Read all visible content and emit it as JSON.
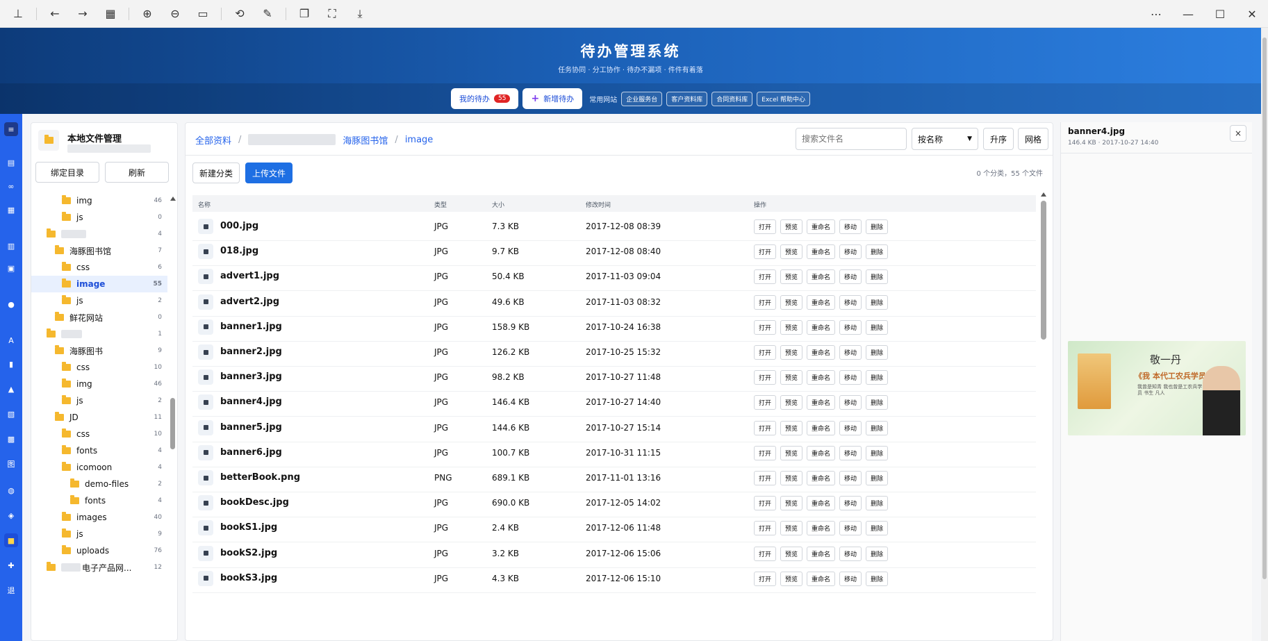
{
  "app": {
    "title": "待办管理系统",
    "subtitle": "任务协同 · 分工协作 · 待办不漏项 · 件件有着落",
    "nav": {
      "my_todos_label": "我的待办",
      "my_todos_count": "55",
      "new_todo_label": "新增待办",
      "common_sites_label": "常用网站",
      "sites": [
        "企业服务台",
        "客户资料库",
        "合同资料库",
        "Excel 帮助中心"
      ]
    }
  },
  "rail": {
    "items": [
      "menu-icon",
      "document-icon",
      "link-icon",
      "calendar-icon",
      "book-icon",
      "clipboard-icon",
      "chat-icon",
      "font-icon",
      "chart-icon",
      "bell-icon",
      "report-icon",
      "building-icon",
      "image-icon",
      "globe-icon",
      "cube-icon",
      "folder-icon",
      "puzzle-icon",
      "logout-icon"
    ],
    "labels": {
      "font": "A",
      "image": "图",
      "logout": "退"
    }
  },
  "file_tree": {
    "title": "本地文件管理",
    "bind_dir_label": "绑定目录",
    "refresh_label": "刷新",
    "items": [
      {
        "label": "img",
        "count": "46"
      },
      {
        "label": "js",
        "count": "0"
      },
      {
        "label": "",
        "count": "4"
      },
      {
        "label": "海豚图书馆",
        "count": "7"
      },
      {
        "label": "css",
        "count": "6"
      },
      {
        "label": "image",
        "count": "55"
      },
      {
        "label": "js",
        "count": "2"
      },
      {
        "label": "鲜花网站",
        "count": "0"
      },
      {
        "label": "",
        "count": "1"
      },
      {
        "label": "海豚图书",
        "count": "9"
      },
      {
        "label": "css",
        "count": "10"
      },
      {
        "label": "img",
        "count": "46"
      },
      {
        "label": "js",
        "count": "2"
      },
      {
        "label": "JD",
        "count": "11"
      },
      {
        "label": "css",
        "count": "10"
      },
      {
        "label": "fonts",
        "count": "4"
      },
      {
        "label": "icomoon",
        "count": "4"
      },
      {
        "label": "demo-files",
        "count": "2"
      },
      {
        "label": "fonts",
        "count": "4"
      },
      {
        "label": "images",
        "count": "40"
      },
      {
        "label": "js",
        "count": "9"
      },
      {
        "label": "uploads",
        "count": "76"
      },
      {
        "label": "电子产品网...",
        "count": "12"
      }
    ]
  },
  "main": {
    "breadcrumb": [
      "全部资料",
      "海豚图书馆",
      "image"
    ],
    "search_placeholder": "搜索文件名",
    "sort_by": "按名称",
    "order_label": "升序",
    "view_label": "网格",
    "new_category_label": "新建分类",
    "upload_label": "上传文件",
    "summary": "0 个分类，55 个文件",
    "columns": [
      "名称",
      "类型",
      "大小",
      "修改时间",
      "操作"
    ],
    "actions": [
      "打开",
      "预览",
      "重命名",
      "移动",
      "删除"
    ],
    "rows": [
      {
        "name": "000.jpg",
        "type": "JPG",
        "size": "7.3 KB",
        "time": "2017-12-08 08:39"
      },
      {
        "name": "018.jpg",
        "type": "JPG",
        "size": "9.7 KB",
        "time": "2017-12-08 08:40"
      },
      {
        "name": "advert1.jpg",
        "type": "JPG",
        "size": "50.4 KB",
        "time": "2017-11-03 09:04"
      },
      {
        "name": "advert2.jpg",
        "type": "JPG",
        "size": "49.6 KB",
        "time": "2017-11-03 08:32"
      },
      {
        "name": "banner1.jpg",
        "type": "JPG",
        "size": "158.9 KB",
        "time": "2017-10-24 16:38"
      },
      {
        "name": "banner2.jpg",
        "type": "JPG",
        "size": "126.2 KB",
        "time": "2017-10-25 15:32"
      },
      {
        "name": "banner3.jpg",
        "type": "JPG",
        "size": "98.2 KB",
        "time": "2017-10-27 11:48"
      },
      {
        "name": "banner4.jpg",
        "type": "JPG",
        "size": "146.4 KB",
        "time": "2017-10-27 14:40"
      },
      {
        "name": "banner5.jpg",
        "type": "JPG",
        "size": "144.6 KB",
        "time": "2017-10-27 15:14"
      },
      {
        "name": "banner6.jpg",
        "type": "JPG",
        "size": "100.7 KB",
        "time": "2017-10-31 11:15"
      },
      {
        "name": "betterBook.png",
        "type": "PNG",
        "size": "689.1 KB",
        "time": "2017-11-01 13:16"
      },
      {
        "name": "bookDesc.jpg",
        "type": "JPG",
        "size": "690.0 KB",
        "time": "2017-12-05 14:02"
      },
      {
        "name": "bookS1.jpg",
        "type": "JPG",
        "size": "2.4 KB",
        "time": "2017-12-06 11:48"
      },
      {
        "name": "bookS2.jpg",
        "type": "JPG",
        "size": "3.2 KB",
        "time": "2017-12-06 15:06"
      },
      {
        "name": "bookS3.jpg",
        "type": "JPG",
        "size": "4.3 KB",
        "time": "2017-12-06 15:10"
      }
    ]
  },
  "preview": {
    "name": "banner4.jpg",
    "meta": "146.4 KB · 2017-10-27 14:40",
    "close": "×",
    "image_text_1": "敬一丹",
    "image_text_2": "《我 本代工农兵学员》",
    "image_text_3": "我曾是知青 我也曾是工农兵学员 书生 凡人"
  },
  "toolbar": {
    "icons": [
      "pin-icon",
      "back-icon",
      "forward-icon",
      "grid-icon",
      "zoom-in-icon",
      "zoom-out-icon",
      "fit-icon",
      "rotate-icon",
      "edit-icon",
      "copy-icon",
      "screenshot-icon",
      "save-icon"
    ],
    "glyphs": {
      "pin": "⊥",
      "back": "←",
      "forward": "→",
      "grid": "▦",
      "zoom_in": "⊕",
      "zoom_out": "⊖",
      "fit": "▭",
      "rotate": "⟲",
      "edit": "✎",
      "copy": "❐",
      "screenshot": "⛶",
      "save": "⤓",
      "more": "⋯",
      "minimize": "—",
      "maximize": "☐",
      "close": "✕"
    }
  }
}
